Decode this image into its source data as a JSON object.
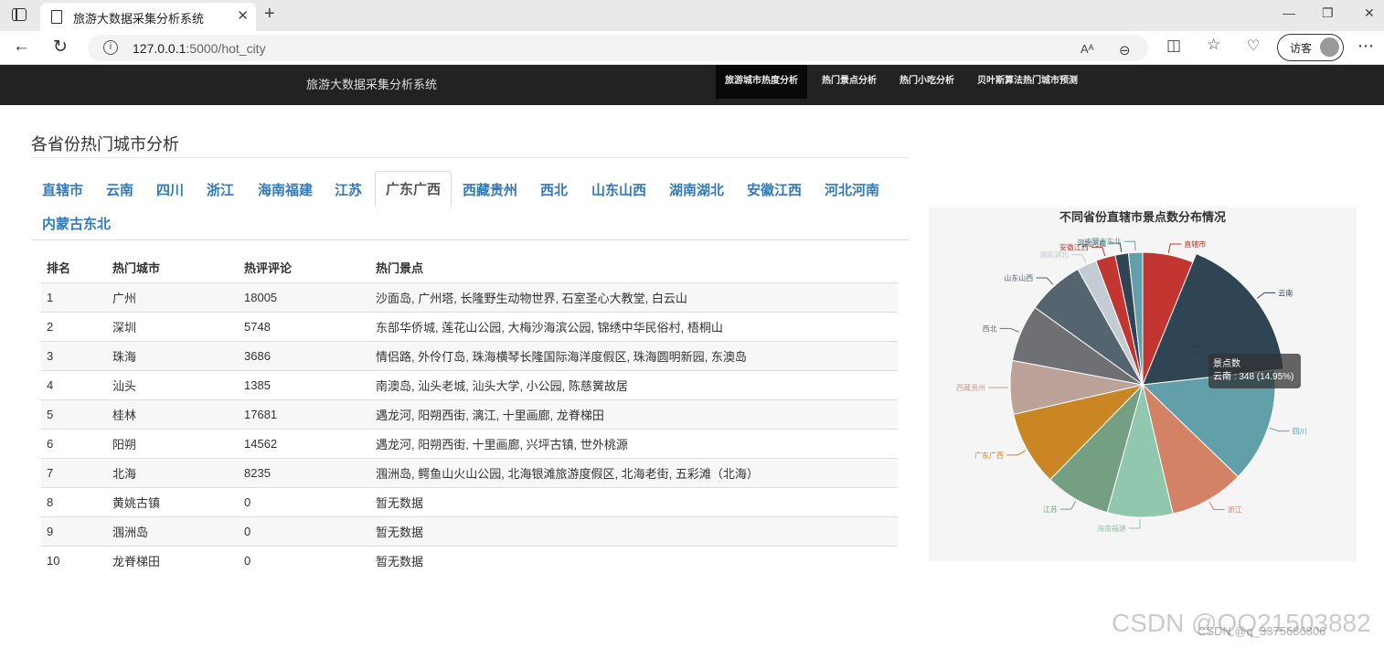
{
  "browser": {
    "tab_title": "旅游大数据采集分析系统",
    "tab_close": "✕",
    "new_tab": "+",
    "url_host": "127.0.0.1",
    "url_rest": ":5000/hot_city",
    "guest_label": "访客",
    "window_minimize": "—",
    "window_restore": "❐",
    "window_close": "✕"
  },
  "navbar": {
    "brand": "旅游大数据采集分析系统",
    "items": [
      "旅游城市热度分析",
      "热门景点分析",
      "热门小吃分析",
      "贝叶斯算法热门城市预测"
    ]
  },
  "page": {
    "title": "各省份热门城市分析",
    "province_tabs": [
      "直辖市",
      "云南",
      "四川",
      "浙江",
      "海南福建",
      "江苏",
      "广东广西",
      "西藏贵州",
      "西北",
      "山东山西",
      "湖南湖北",
      "安徽江西",
      "河北河南",
      "内蒙古东北"
    ],
    "active_tab": "广东广西"
  },
  "table": {
    "headers": [
      "排名",
      "热门城市",
      "热评评论",
      "热门景点"
    ],
    "rows": [
      [
        "1",
        "广州",
        "18005",
        "沙面岛, 广州塔, 长隆野生动物世界, 石室圣心大教堂, 白云山"
      ],
      [
        "2",
        "深圳",
        "5748",
        "东部华侨城, 莲花山公园, 大梅沙海滨公园, 锦绣中华民俗村, 梧桐山"
      ],
      [
        "3",
        "珠海",
        "3686",
        "情侣路, 外伶仃岛, 珠海横琴长隆国际海洋度假区, 珠海圆明新园, 东澳岛"
      ],
      [
        "4",
        "汕头",
        "1385",
        "南澳岛, 汕头老城, 汕头大学, 小公园, 陈慈黉故居"
      ],
      [
        "5",
        "桂林",
        "17681",
        "遇龙河, 阳朔西街, 漓江, 十里画廊, 龙脊梯田"
      ],
      [
        "6",
        "阳朔",
        "14562",
        "遇龙河, 阳朔西街, 十里画廊, 兴坪古镇, 世外桃源"
      ],
      [
        "7",
        "北海",
        "8235",
        "涠洲岛, 鳄鱼山火山公园, 北海银滩旅游度假区, 北海老街, 五彩滩（北海）"
      ],
      [
        "8",
        "黄姚古镇",
        "0",
        "暂无数据"
      ],
      [
        "9",
        "涠洲岛",
        "0",
        "暂无数据"
      ],
      [
        "10",
        "龙脊梯田",
        "0",
        "暂无数据"
      ]
    ]
  },
  "chart_data": {
    "type": "pie",
    "title": "不同省份直辖市景点数分布情况",
    "series_name": "景点数",
    "slices": [
      {
        "name": "直辖市",
        "value": 126,
        "color": "#c23531"
      },
      {
        "name": "云南",
        "value": 348,
        "color": "#2f4554"
      },
      {
        "name": "四川",
        "value": 285,
        "color": "#61a0a8"
      },
      {
        "name": "浙江",
        "value": 186,
        "color": "#d48265"
      },
      {
        "name": "海南福建",
        "value": 163,
        "color": "#91c7ae"
      },
      {
        "name": "江苏",
        "value": 163,
        "color": "#749f83"
      },
      {
        "name": "广东广西",
        "value": 186,
        "color": "#ca8622"
      },
      {
        "name": "西藏贵州",
        "value": 133,
        "color": "#bda29a"
      },
      {
        "name": "西北",
        "value": 142,
        "color": "#6e7074"
      },
      {
        "name": "山东山西",
        "value": 142,
        "color": "#546570"
      },
      {
        "name": "湖南湖北",
        "value": 49,
        "color": "#c4ccd3"
      },
      {
        "name": "安徽江西",
        "value": 49,
        "color": "#c23531"
      },
      {
        "name": "河北河南",
        "value": 33,
        "color": "#2f4554"
      },
      {
        "name": "内蒙古东北",
        "value": 35,
        "color": "#61a0a8"
      }
    ],
    "tooltip": {
      "title": "景点数",
      "text": "云南 : 348 (14.95%)"
    }
  },
  "watermark": "CSDN @QQ21503882",
  "watermark2": "CSDN @q_3375686806"
}
